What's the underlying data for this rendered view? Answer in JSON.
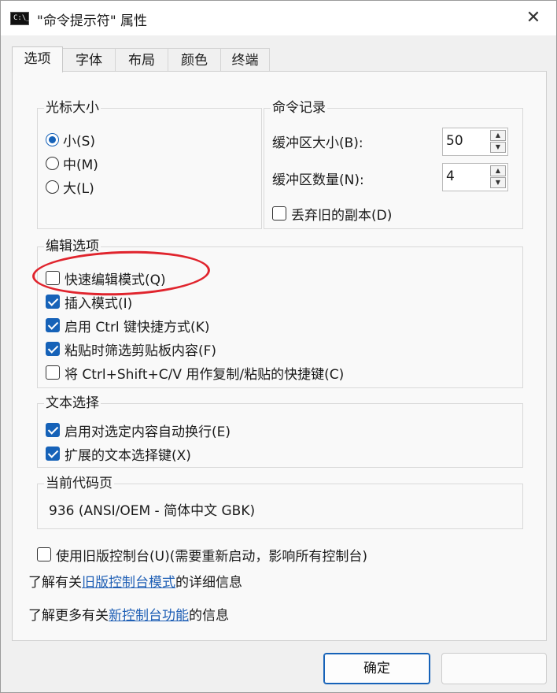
{
  "window": {
    "title": "\"命令提示符\" 属性",
    "app_icon_text": "C:\\_",
    "close_glyph": "✕"
  },
  "tabs": [
    {
      "label": "选项",
      "active": true
    },
    {
      "label": "字体",
      "active": false
    },
    {
      "label": "布局",
      "active": false
    },
    {
      "label": "颜色",
      "active": false
    },
    {
      "label": "终端",
      "active": false
    }
  ],
  "cursor_size": {
    "legend": "光标大小",
    "options": [
      {
        "label": "小(S)",
        "selected": true
      },
      {
        "label": "中(M)",
        "selected": false
      },
      {
        "label": "大(L)",
        "selected": false
      }
    ]
  },
  "command_history": {
    "legend": "命令记录",
    "buffer_size_label": "缓冲区大小(B):",
    "buffer_size_value": "50",
    "buffer_count_label": "缓冲区数量(N):",
    "buffer_count_value": "4",
    "discard_label": "丢弃旧的副本(D)",
    "discard_checked": false,
    "spin_up": "▲",
    "spin_down": "▼"
  },
  "edit_options": {
    "legend": "编辑选项",
    "items": [
      {
        "label": "快速编辑模式(Q)",
        "checked": false
      },
      {
        "label": "插入模式(I)",
        "checked": true
      },
      {
        "label": "启用 Ctrl 键快捷方式(K)",
        "checked": true
      },
      {
        "label": "粘贴时筛选剪贴板内容(F)",
        "checked": true
      },
      {
        "label": "将 Ctrl+Shift+C/V 用作复制/粘贴的快捷键(C)",
        "checked": false
      }
    ]
  },
  "text_selection": {
    "legend": "文本选择",
    "items": [
      {
        "label": "启用对选定内容自动换行(E)",
        "checked": true
      },
      {
        "label": "扩展的文本选择键(X)",
        "checked": true
      }
    ]
  },
  "codepage": {
    "legend": "当前代码页",
    "value": "936   (ANSI/OEM - 简体中文 GBK)"
  },
  "legacy": {
    "label": "使用旧版控制台(U)(需要重新启动，影响所有控制台)",
    "checked": false,
    "info1_prefix": "了解有关",
    "info1_link": "旧版控制台模式",
    "info1_suffix": "的详细信息",
    "info2_prefix": "了解更多有关",
    "info2_link": "新控制台功能",
    "info2_suffix": "的信息"
  },
  "buttons": {
    "ok": "确定",
    "cancel": ""
  },
  "colors": {
    "accent": "#1662b8",
    "annotation": "#e0242d",
    "link": "#1f5fb5"
  }
}
